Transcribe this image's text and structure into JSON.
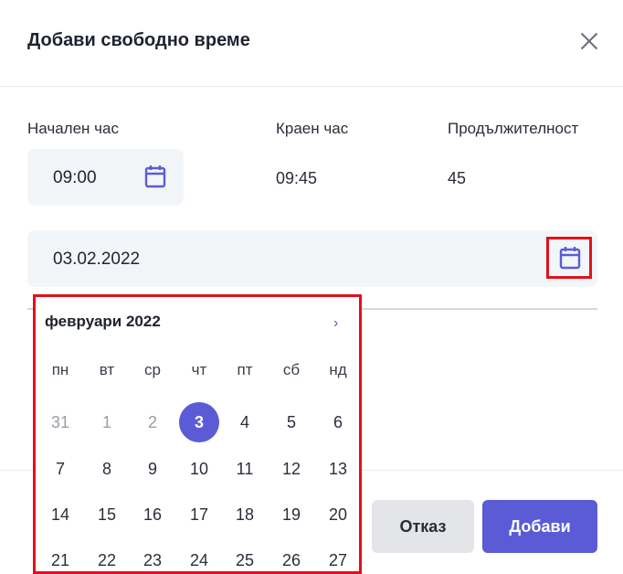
{
  "dialog": {
    "title": "Добави свободно време"
  },
  "fields": {
    "start_label": "Начален час",
    "start_value": "09:00",
    "end_label": "Краен час",
    "end_value": "09:45",
    "duration_label": "Продължителност",
    "duration_value": "45",
    "date_value": "03.02.2022"
  },
  "calendar": {
    "month_label": "февруари 2022",
    "next_glyph": "›",
    "weekdays": [
      "пн",
      "вт",
      "ср",
      "чт",
      "пт",
      "сб",
      "нд"
    ],
    "weeks": [
      [
        "31",
        "1",
        "2",
        "3",
        "4",
        "5",
        "6"
      ],
      [
        "7",
        "8",
        "9",
        "10",
        "11",
        "12",
        "13"
      ],
      [
        "14",
        "15",
        "16",
        "17",
        "18",
        "19",
        "20"
      ],
      [
        "21",
        "22",
        "23",
        "24",
        "25",
        "26",
        "27"
      ]
    ],
    "selected_day": "3"
  },
  "footer": {
    "cancel_label": "Отказ",
    "add_label": "Добави"
  },
  "colors": {
    "accent": "#5b5bd6",
    "highlight_border": "#e3101b"
  },
  "icons": {
    "close": "close-icon",
    "calendar": "calendar-icon",
    "next": "chevron-right-icon"
  }
}
